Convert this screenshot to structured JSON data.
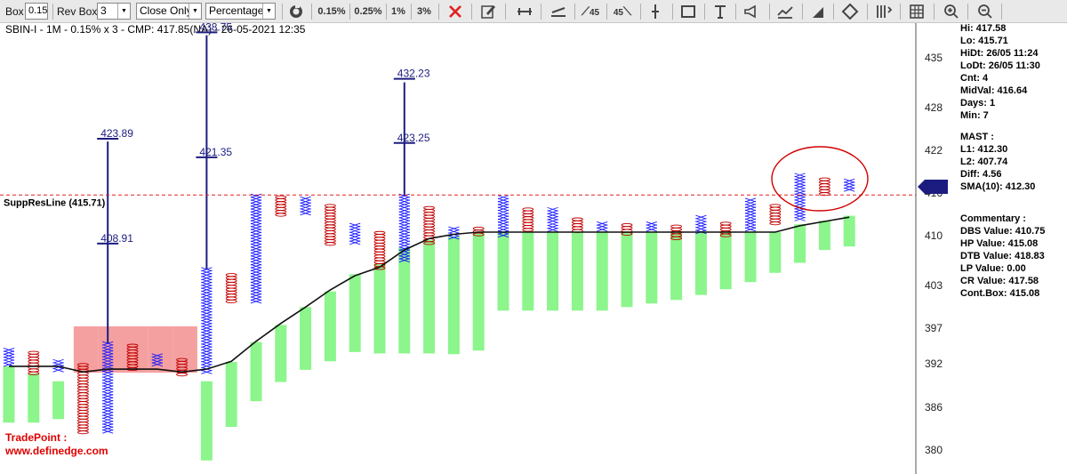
{
  "toolbar": {
    "box_label": "Box",
    "box_value": "0.15",
    "rev_box_label": "Rev Box",
    "rev_box_value": "3",
    "method_value": "Close Only",
    "box_type_value": "Percentage",
    "btn_015": "0.15%",
    "btn_025": "0.25%",
    "btn_1": "1%",
    "btn_3": "3%",
    "btn_45a": "45",
    "btn_45b": "45"
  },
  "chart_header": "SBIN-I - 1M - 0.15% x 3 - CMP: 417.85(NA) - 26-05-2021 12:35",
  "suppres_label": "SuppResLine (415.71)",
  "watermark": {
    "line1": "TradePoint :",
    "line2": "www.definedge.com"
  },
  "colors": {
    "x_mark": "#1a1aff",
    "o_mark": "#c00000",
    "green_bar": "#8cf58c",
    "pink_bar": "#f5a0a0",
    "suppres": "#e02020",
    "axis_border": "#555555",
    "dark_blue": "#1c1c80"
  },
  "info": {
    "hi": "Hi: 417.58",
    "lo": "Lo: 415.71",
    "hidt": "HiDt: 26/05 11:24",
    "lodt": "LoDt: 26/05 11:30",
    "cnt": "Cnt: 4",
    "midval": "MidVal: 416.64",
    "days": "Days: 1",
    "min": "Min: 7",
    "mast": "MAST :",
    "l1": "L1: 412.30",
    "l2": "L2: 407.74",
    "diff": "Diff: 4.56",
    "sma": "SMA(10): 412.30",
    "commentary": "Commentary :",
    "dbs": "DBS Value:  410.75",
    "hp": "HP Value: 415.08",
    "dtb": "DTB Value: 418.83",
    "lp": "LP Value: 0.00",
    "cr": "CR Value: 417.58",
    "contbox": "Cont.Box: 415.08"
  },
  "chart_data": {
    "type": "point-and-figure",
    "title": "SBIN-I - 1M - 0.15% x 3 - CMP: 417.85(NA) - 26-05-2021 12:35",
    "ylim": [
      376.6,
      439.8
    ],
    "y_ticks": [
      {
        "label": "435",
        "value": 435
      },
      {
        "label": "428",
        "value": 428
      },
      {
        "label": "422",
        "value": 422
      },
      {
        "label": "416",
        "value": 416
      },
      {
        "label": "410",
        "value": 410
      },
      {
        "label": "403",
        "value": 403
      },
      {
        "label": "397",
        "value": 397
      },
      {
        "label": "392",
        "value": 392
      },
      {
        "label": "386",
        "value": 386
      },
      {
        "label": "380",
        "value": 380
      }
    ],
    "suppres_value": 415.71,
    "current_price_marker": 416.9,
    "columns": [
      {
        "col": 0,
        "type": "X",
        "low": 391.9,
        "high": 394.0
      },
      {
        "col": 1,
        "type": "O",
        "low": 390.7,
        "high": 393.6
      },
      {
        "col": 2,
        "type": "X",
        "low": 390.9,
        "high": 392.4
      },
      {
        "col": 3,
        "type": "O",
        "low": 382.3,
        "high": 391.9
      },
      {
        "col": 4,
        "type": "X",
        "low": 382.5,
        "high": 394.9
      },
      {
        "col": 5,
        "type": "O",
        "low": 391.3,
        "high": 394.6
      },
      {
        "col": 6,
        "type": "X",
        "low": 391.7,
        "high": 393.2
      },
      {
        "col": 7,
        "type": "O",
        "low": 390.5,
        "high": 392.6
      },
      {
        "col": 8,
        "type": "X",
        "low": 390.9,
        "high": 405.3
      },
      {
        "col": 9,
        "type": "O",
        "low": 400.4,
        "high": 404.5
      },
      {
        "col": 10,
        "type": "X",
        "low": 400.4,
        "high": 415.6
      },
      {
        "col": 11,
        "type": "O",
        "low": 412.6,
        "high": 415.4
      },
      {
        "col": 12,
        "type": "X",
        "low": 413.0,
        "high": 415.2
      },
      {
        "col": 13,
        "type": "O",
        "low": 408.8,
        "high": 414.2
      },
      {
        "col": 14,
        "type": "X",
        "low": 408.9,
        "high": 411.5
      },
      {
        "col": 15,
        "type": "O",
        "low": 405.3,
        "high": 410.4
      },
      {
        "col": 16,
        "type": "X",
        "low": 406.2,
        "high": 415.6
      },
      {
        "col": 17,
        "type": "O",
        "low": 408.6,
        "high": 413.9
      },
      {
        "col": 18,
        "type": "X",
        "low": 409.6,
        "high": 411.0
      },
      {
        "col": 19,
        "type": "O",
        "low": 409.8,
        "high": 411.0
      },
      {
        "col": 20,
        "type": "X",
        "low": 410.0,
        "high": 415.4
      },
      {
        "col": 21,
        "type": "O",
        "low": 410.5,
        "high": 413.7
      },
      {
        "col": 22,
        "type": "X",
        "low": 410.5,
        "high": 413.7
      },
      {
        "col": 23,
        "type": "O",
        "low": 410.5,
        "high": 412.3
      },
      {
        "col": 24,
        "type": "X",
        "low": 410.5,
        "high": 411.7
      },
      {
        "col": 25,
        "type": "O",
        "low": 410.0,
        "high": 411.5
      },
      {
        "col": 26,
        "type": "X",
        "low": 410.5,
        "high": 411.7
      },
      {
        "col": 27,
        "type": "O",
        "low": 409.4,
        "high": 411.3
      },
      {
        "col": 28,
        "type": "X",
        "low": 410.5,
        "high": 412.6
      },
      {
        "col": 29,
        "type": "O",
        "low": 410.0,
        "high": 411.7
      },
      {
        "col": 30,
        "type": "X",
        "low": 410.5,
        "high": 415.0
      },
      {
        "col": 31,
        "type": "O",
        "low": 411.7,
        "high": 414.2
      },
      {
        "col": 32,
        "type": "X",
        "low": 412.1,
        "high": 418.5
      },
      {
        "col": 33,
        "type": "O",
        "low": 415.8,
        "high": 417.9
      },
      {
        "col": 34,
        "type": "X",
        "low": 416.2,
        "high": 417.7
      }
    ],
    "green_bars": [
      {
        "col": 0,
        "low": 383.8,
        "high": 391.7
      },
      {
        "col": 1,
        "low": 383.8,
        "high": 390.7
      },
      {
        "col": 2,
        "low": 384.3,
        "high": 389.6
      },
      {
        "col": 8,
        "low": 378.5,
        "high": 389.6
      },
      {
        "col": 9,
        "low": 383.2,
        "high": 392.3
      },
      {
        "col": 10,
        "low": 386.8,
        "high": 395.1
      },
      {
        "col": 11,
        "low": 389.5,
        "high": 397.5
      },
      {
        "col": 12,
        "low": 391.2,
        "high": 400.0
      },
      {
        "col": 13,
        "low": 392.4,
        "high": 402.2
      },
      {
        "col": 14,
        "low": 393.7,
        "high": 404.6
      },
      {
        "col": 15,
        "low": 393.5,
        "high": 406.0
      },
      {
        "col": 16,
        "low": 393.5,
        "high": 408.3
      },
      {
        "col": 17,
        "low": 393.5,
        "high": 409.4
      },
      {
        "col": 18,
        "low": 393.4,
        "high": 409.9
      },
      {
        "col": 19,
        "low": 393.9,
        "high": 410.5
      },
      {
        "col": 20,
        "low": 399.5,
        "high": 410.5
      },
      {
        "col": 21,
        "low": 399.5,
        "high": 410.5
      },
      {
        "col": 22,
        "low": 399.5,
        "high": 410.5
      },
      {
        "col": 23,
        "low": 399.5,
        "high": 410.5
      },
      {
        "col": 24,
        "low": 399.5,
        "high": 410.5
      },
      {
        "col": 25,
        "low": 400.0,
        "high": 410.5
      },
      {
        "col": 26,
        "low": 400.5,
        "high": 410.5
      },
      {
        "col": 27,
        "low": 401.0,
        "high": 410.5
      },
      {
        "col": 28,
        "low": 401.7,
        "high": 410.5
      },
      {
        "col": 29,
        "low": 402.5,
        "high": 410.5
      },
      {
        "col": 30,
        "low": 403.5,
        "high": 410.5
      },
      {
        "col": 31,
        "low": 404.8,
        "high": 410.5
      },
      {
        "col": 32,
        "low": 406.2,
        "high": 411.6
      },
      {
        "col": 33,
        "low": 408.0,
        "high": 412.1
      },
      {
        "col": 34,
        "low": 408.5,
        "high": 412.8
      }
    ],
    "pink_bars": [
      {
        "col": 3,
        "low": 390.8,
        "high": 397.3
      },
      {
        "col": 4,
        "low": 390.8,
        "high": 397.3
      },
      {
        "col": 5,
        "low": 390.8,
        "high": 397.3
      },
      {
        "col": 6,
        "low": 390.8,
        "high": 397.3
      },
      {
        "col": 7,
        "low": 390.8,
        "high": 397.3
      }
    ],
    "ma_line": [
      {
        "col": 0,
        "value": 391.7
      },
      {
        "col": 1,
        "value": 391.7
      },
      {
        "col": 2,
        "value": 391.7
      },
      {
        "col": 3,
        "value": 390.9
      },
      {
        "col": 4,
        "value": 391.3
      },
      {
        "col": 5,
        "value": 391.3
      },
      {
        "col": 6,
        "value": 391.3
      },
      {
        "col": 7,
        "value": 390.9
      },
      {
        "col": 8,
        "value": 391.3
      },
      {
        "col": 9,
        "value": 392.4
      },
      {
        "col": 10,
        "value": 395.2
      },
      {
        "col": 11,
        "value": 397.7
      },
      {
        "col": 12,
        "value": 400.0
      },
      {
        "col": 13,
        "value": 402.4
      },
      {
        "col": 14,
        "value": 404.4
      },
      {
        "col": 15,
        "value": 405.6
      },
      {
        "col": 16,
        "value": 408.0
      },
      {
        "col": 17,
        "value": 409.6
      },
      {
        "col": 18,
        "value": 410.2
      },
      {
        "col": 19,
        "value": 410.5
      },
      {
        "col": 20,
        "value": 410.5
      },
      {
        "col": 21,
        "value": 410.5
      },
      {
        "col": 22,
        "value": 410.5
      },
      {
        "col": 23,
        "value": 410.5
      },
      {
        "col": 24,
        "value": 410.5
      },
      {
        "col": 25,
        "value": 410.5
      },
      {
        "col": 26,
        "value": 410.5
      },
      {
        "col": 27,
        "value": 410.5
      },
      {
        "col": 28,
        "value": 410.5
      },
      {
        "col": 29,
        "value": 410.5
      },
      {
        "col": 30,
        "value": 410.5
      },
      {
        "col": 31,
        "value": 410.5
      },
      {
        "col": 32,
        "value": 411.4
      },
      {
        "col": 33,
        "value": 412.0
      },
      {
        "col": 34,
        "value": 412.6
      }
    ],
    "targets": [
      {
        "col": 4,
        "low": 394.9,
        "high": 423.2,
        "labels": [
          {
            "text": "423.89",
            "value": 423.6
          },
          {
            "text": "408.91",
            "value": 408.9
          }
        ]
      },
      {
        "col": 8,
        "low": 405.3,
        "high": 438.1,
        "labels": [
          {
            "text": "438.75",
            "value": 438.5
          },
          {
            "text": "421.35",
            "value": 421.0
          }
        ]
      },
      {
        "col": 16,
        "low": 415.6,
        "high": 431.5,
        "labels": [
          {
            "text": "432.23",
            "value": 432.0
          },
          {
            "text": "423.25",
            "value": 423.0
          }
        ]
      }
    ]
  }
}
